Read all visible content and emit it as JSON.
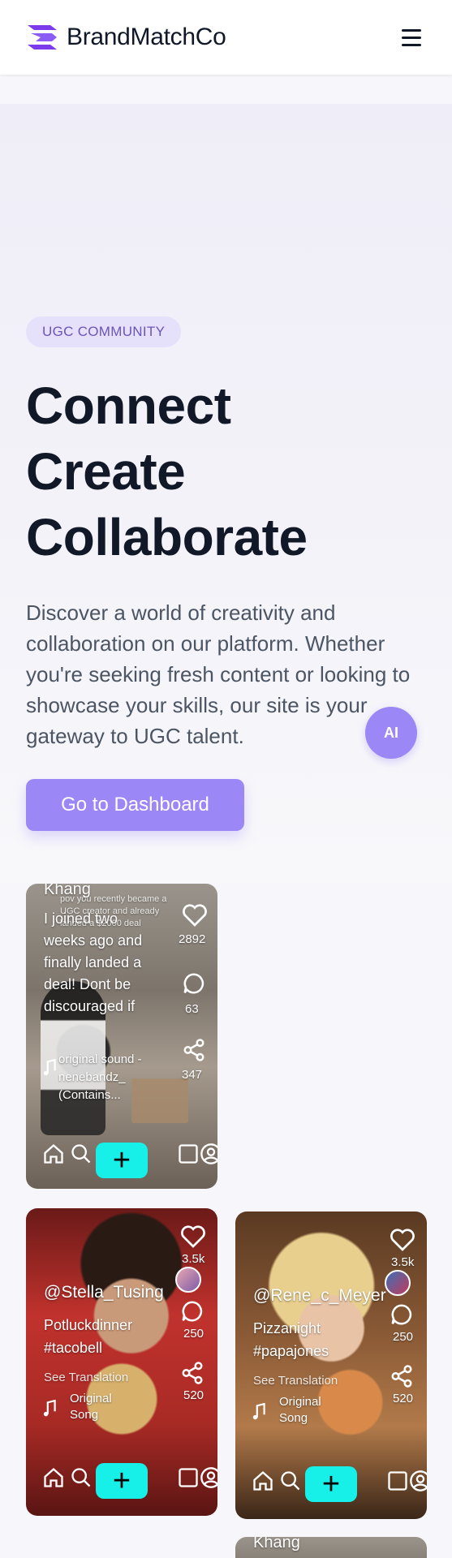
{
  "header": {
    "brand_name": "BrandMatchCo",
    "logo_icon": "brand-chevron-logo",
    "menu_icon": "hamburger-icon"
  },
  "hero": {
    "badge": "UGC COMMUNITY",
    "title_lines": [
      "Connect",
      "Create",
      "Collaborate"
    ],
    "description": "Discover a world of creativity and collaboration on our platform. Whether you're seeking fresh content or looking to showcase your skills, our site is your gateway to UGC talent.",
    "cta_label": "Go to Dashboard",
    "ai_button_label": "AI"
  },
  "colors": {
    "accent": "#9b87f5",
    "badge_bg": "#e6e1fb",
    "badge_text": "#6a55b8",
    "plus_button": "#16f0e8"
  },
  "cards": [
    {
      "username": "Khang",
      "caption": "I joined two weeks ago and finally landed a deal! Dont be discouraged if",
      "overlay_text": "pov you recently became a UGC creator and already landed a $2000 deal",
      "likes": "2892",
      "comments": "63",
      "shares": "347",
      "sound": "original sound - nenebandz_ (Contains..."
    },
    {
      "username": "@Stella_Tusing",
      "caption_line1": "Potluckdinner",
      "caption_line2": "#tacobell",
      "see_translation": "See Translation",
      "sound_line1": "Original",
      "sound_line2": "Song",
      "likes": "3.5k",
      "comments": "250",
      "shares": "520"
    },
    {
      "username": "@Rene_c_Meyer",
      "caption_line1": "Pizzanight",
      "caption_line2": "#papajones",
      "see_translation": "See Translation",
      "sound_line1": "Original",
      "sound_line2": "Song",
      "likes": "3.5k",
      "comments": "250",
      "shares": "520"
    },
    {
      "username": "Khang"
    }
  ]
}
